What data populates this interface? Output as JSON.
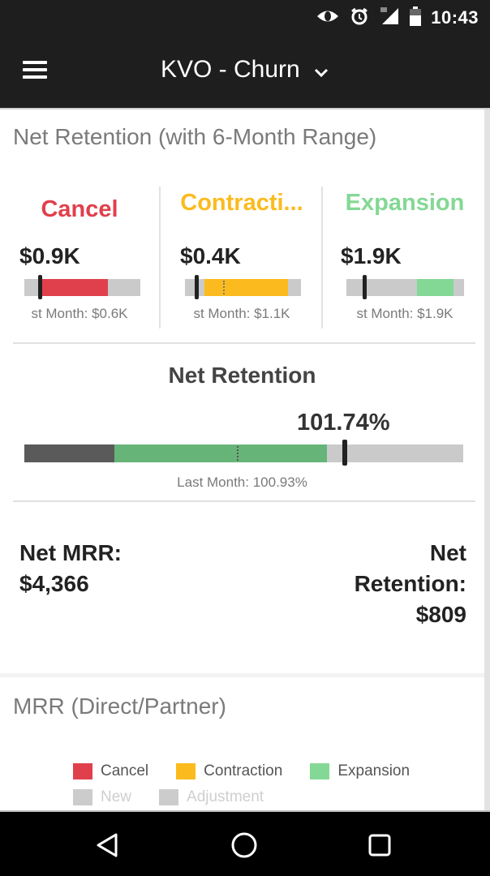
{
  "status_bar": {
    "time": "10:43",
    "icons": [
      "eye-icon",
      "alarm-icon",
      "signal-icon",
      "battery-icon"
    ]
  },
  "app_bar": {
    "menu_icon": "hamburger-menu-icon",
    "title": "KVO - Churn",
    "dropdown_icon": "chevron-down-icon"
  },
  "net_retention_card": {
    "title": "Net Retention (with 6-Month Range)",
    "kpis": [
      {
        "label": "Cancel",
        "color": "#e0404c",
        "value": "$0.9K",
        "sub_label": "st Month: $0.6K",
        "range_start_fraction": 0.15,
        "value_fraction": 0.72,
        "marker_fraction": 0.13,
        "dots_fraction": null
      },
      {
        "label": "Contracti...",
        "color": "#fbbb1e",
        "value": "$0.4K",
        "sub_label": "st Month: $1.1K",
        "range_start_fraction": 0.17,
        "value_fraction": 0.89,
        "marker_fraction": 0.1,
        "dots_fraction": 0.33
      },
      {
        "label": "Expansion",
        "color": "#84d895",
        "value": "$1.9K",
        "sub_label": "st Month: $1.9K",
        "range_start_fraction": 0.6,
        "value_fraction": 0.91,
        "marker_fraction": 0.15,
        "dots_fraction": null
      }
    ],
    "net_retention": {
      "title": "Net Retention",
      "value": "101.74%",
      "sub_label": "Last Month: 100.93%",
      "dark_segment_fraction": 0.205,
      "green_segment_end_fraction": 0.69,
      "marker_fraction": 0.73,
      "dots_fraction": 0.485,
      "dark_color": "#5a5a5a",
      "green_color": "#66b478"
    },
    "net_mrr_label": "Net MRR:",
    "net_mrr_value": "$4,366",
    "net_retention_amount_label_1": "Net",
    "net_retention_amount_label_2": "Retention:",
    "net_retention_amount_value": "$809"
  },
  "mrr_card": {
    "title": "MRR (Direct/Partner)",
    "legend": [
      {
        "label": "Cancel",
        "color": "#e0404c",
        "muted": false
      },
      {
        "label": "Contraction",
        "color": "#fbbb1e",
        "muted": false
      },
      {
        "label": "Expansion",
        "color": "#84d895",
        "muted": false
      },
      {
        "label": "New",
        "color": "#cccccc",
        "muted": true
      },
      {
        "label": "Adjustment",
        "color": "#cccccc",
        "muted": true
      }
    ]
  },
  "nav_bar": {
    "buttons": [
      "back-icon",
      "home-icon",
      "recents-icon"
    ]
  }
}
